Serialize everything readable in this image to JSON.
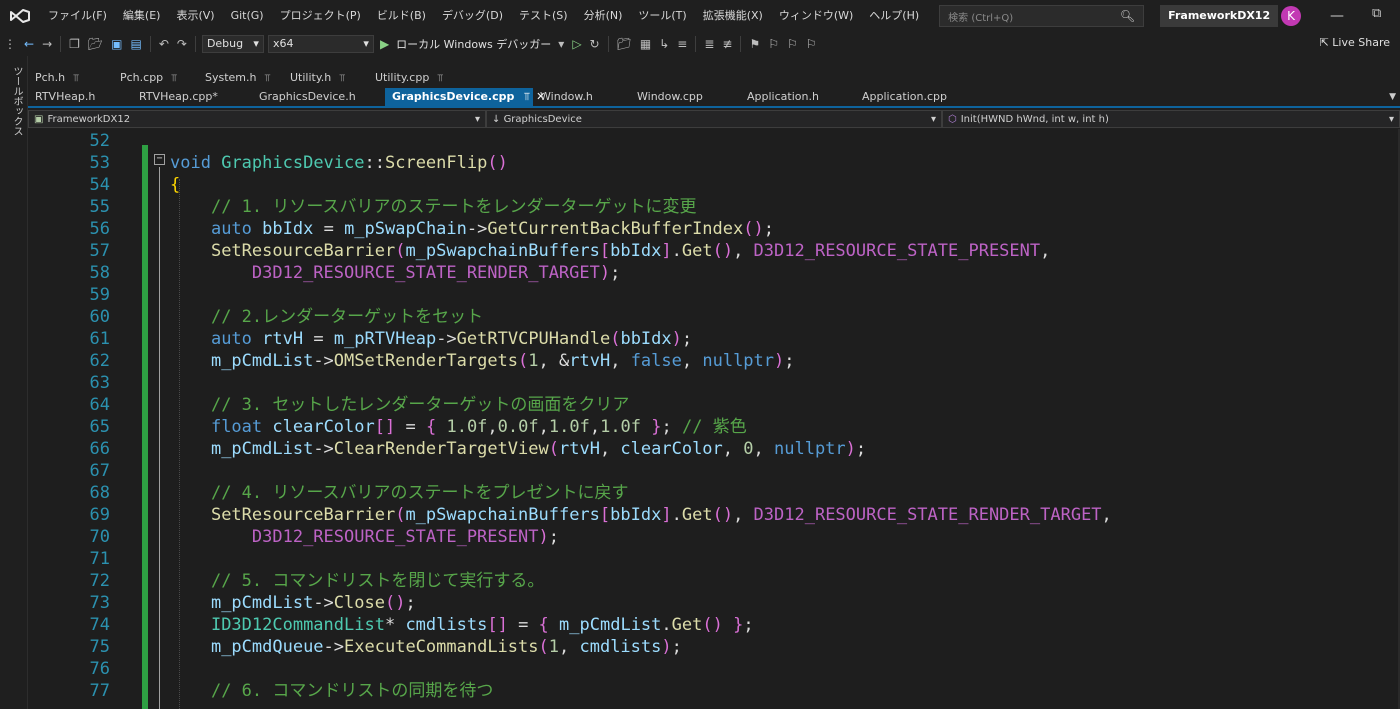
{
  "menubar": {
    "items": [
      "ファイル(F)",
      "編集(E)",
      "表示(V)",
      "Git(G)",
      "プロジェクト(P)",
      "ビルド(B)",
      "デバッグ(D)",
      "テスト(S)",
      "分析(N)",
      "ツール(T)",
      "拡張機能(X)",
      "ウィンドウ(W)",
      "ヘルプ(H)"
    ],
    "search_placeholder": "検索 (Ctrl+Q)",
    "solution_name": "FrameworkDX12",
    "avatar_initial": "K"
  },
  "toolbar": {
    "configuration": "Debug",
    "platform": "x64",
    "run_label": "ローカル Windows デバッガー",
    "live_share": "Live Share"
  },
  "toolbox": {
    "label": "ツールボックス"
  },
  "pinned_tabs": [
    "Pch.h",
    "Pch.cpp",
    "System.h",
    "Utility.h",
    "Utility.cpp"
  ],
  "doc_tabs": [
    {
      "label": "RTVHeap.h"
    },
    {
      "label": "RTVHeap.cpp*"
    },
    {
      "label": "GraphicsDevice.h"
    },
    {
      "label": "GraphicsDevice.cpp",
      "active": true
    },
    {
      "label": "Window.h"
    },
    {
      "label": "Window.cpp"
    },
    {
      "label": "Application.h"
    },
    {
      "label": "Application.cpp"
    }
  ],
  "navbar": {
    "project": "FrameworkDX12",
    "scope": "GraphicsDevice",
    "member": "Init(HWND hWnd, int w, int h)"
  },
  "editor": {
    "line_numbers": [
      "52",
      "53",
      "54",
      "55",
      "56",
      "57",
      "58",
      "59",
      "60",
      "61",
      "62",
      "63",
      "64",
      "65",
      "66",
      "67",
      "68",
      "69",
      "70",
      "71",
      "72",
      "73",
      "74",
      "75",
      "76",
      "77"
    ],
    "lines": [
      "",
      "void GraphicsDevice::ScreenFlip()",
      "{",
      "    // 1. リソースバリアのステートをレンダーターゲットに変更",
      "    auto bbIdx = m_pSwapChain->GetCurrentBackBufferIndex();",
      "    SetResourceBarrier(m_pSwapchainBuffers[bbIdx].Get(), D3D12_RESOURCE_STATE_PRESENT,",
      "        D3D12_RESOURCE_STATE_RENDER_TARGET);",
      "",
      "    // 2.レンダーターゲットをセット",
      "    auto rtvH = m_pRTVHeap->GetRTVCPUHandle(bbIdx);",
      "    m_pCmdList->OMSetRenderTargets(1, &rtvH, false, nullptr);",
      "",
      "    // 3. セットしたレンダーターゲットの画面をクリア",
      "    float clearColor[] = { 1.0f,0.0f,1.0f,1.0f }; // 紫色",
      "    m_pCmdList->ClearRenderTargetView(rtvH, clearColor, 0, nullptr);",
      "",
      "    // 4. リソースバリアのステートをプレゼントに戻す",
      "    SetResourceBarrier(m_pSwapchainBuffers[bbIdx].Get(), D3D12_RESOURCE_STATE_RENDER_TARGET,",
      "        D3D12_RESOURCE_STATE_PRESENT);",
      "",
      "    // 5. コマンドリストを閉じて実行する。",
      "    m_pCmdList->Close();",
      "    ID3D12CommandList* cmdlists[] = { m_pCmdList.Get() };",
      "    m_pCmdQueue->ExecuteCommandLists(1, cmdlists);",
      "",
      "    // 6. コマンドリストの同期を待つ"
    ]
  },
  "colors": {
    "accent": "#0e639c",
    "keyword": "#569cd6",
    "comment": "#57a64a",
    "function": "#dcdcaa",
    "member": "#9cdcfe",
    "macro": "#bd63c5",
    "line_number": "#2b91af",
    "change_bar": "#2ea043"
  }
}
